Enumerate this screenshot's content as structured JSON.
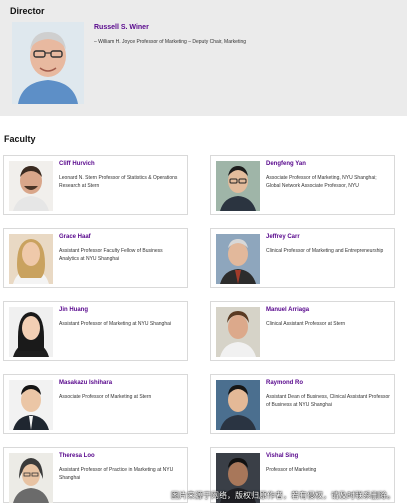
{
  "director": {
    "heading": "Director",
    "name": "Russell S. Winer",
    "title": "– William H. Joyce Professor of Marketing – Deputy Chair, Marketing"
  },
  "faculty": {
    "heading": "Faculty",
    "members": [
      {
        "name": "Cliff Hurvich",
        "title": "Leonard N. Stern Professor of Statistics & Operations Research at Stern"
      },
      {
        "name": "Dengfeng Yan",
        "title": "Associate Professor of Marketing, NYU Shanghai; Global Network Associate Professor, NYU"
      },
      {
        "name": "Grace Haaf",
        "title": "Assistant Professor Faculty Fellow of Business Analytics at NYU Shanghai"
      },
      {
        "name": "Jeffrey Carr",
        "title": "Clinical Professor of Marketing and Entrepreneurship"
      },
      {
        "name": "Jin Huang",
        "title": "Assistant Professor of Marketing at NYU Shanghai"
      },
      {
        "name": "Manuel Arriaga",
        "title": "Clinical Assistant Professor at Stern"
      },
      {
        "name": "Masakazu Ishihara",
        "title": "Associate Professor of Marketing at Stern"
      },
      {
        "name": "Raymond Ro",
        "title": "Assistant Dean of Business, Clinical Assistant Professor of Business at NYU Shanghai"
      },
      {
        "name": "Theresa Loo",
        "title": "Assistant Professor of Practice in Marketing at NYU Shanghai"
      },
      {
        "name": "Vishal Sing",
        "title": "Professor of Marketing"
      }
    ]
  },
  "watermark": "图片来源于网络，版权归原作者，若有侵权，请及时联系删除。"
}
